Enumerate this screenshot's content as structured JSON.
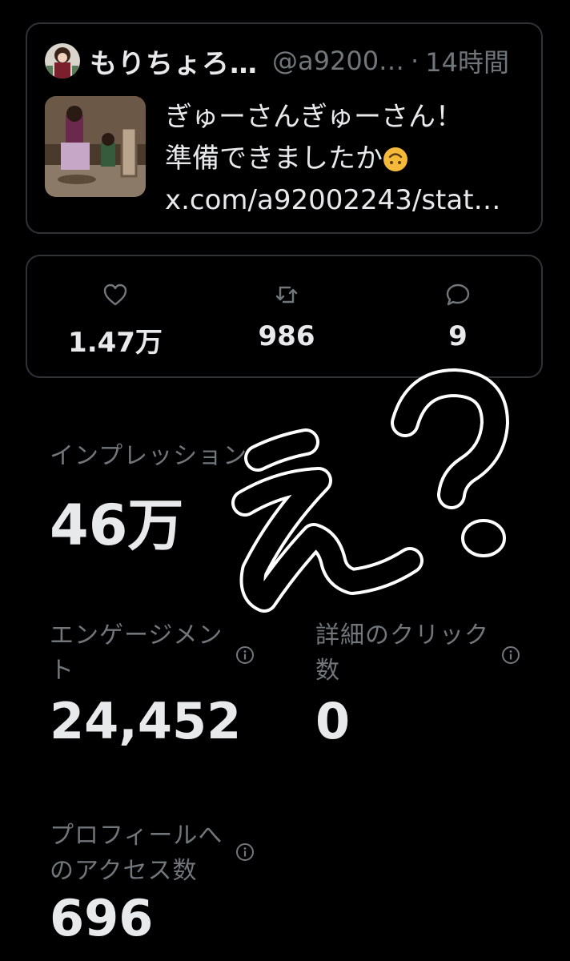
{
  "tweet": {
    "display_name": "もりちょろ…",
    "handle": "@a9200…",
    "separator": "·",
    "time": "14時間",
    "text_line1": "ぎゅーさんぎゅーさん！",
    "text_line2": "準備できましたか",
    "link": "x.com/a92002243/stat…",
    "emoji": "upside-down-face"
  },
  "stats": {
    "likes": "1.47万",
    "retweets": "986",
    "replies": "9",
    "icons": [
      "heart-icon",
      "retweet-icon",
      "reply-icon"
    ]
  },
  "analytics": {
    "impressions_label": "インプレッション",
    "impressions_value": "46万",
    "engagements_label": "エンゲージメント",
    "engagements_value": "24,452",
    "detail_clicks_label": "詳細のクリック数",
    "detail_clicks_value": "0",
    "profile_visits_label": "プロフィールへのアクセス数",
    "profile_visits_value": "696"
  },
  "overlay": {
    "handwritten_text": "え？"
  },
  "colors": {
    "background": "#000000",
    "text": "#e7e9ea",
    "muted": "#71767b",
    "border": "#2f3336"
  }
}
